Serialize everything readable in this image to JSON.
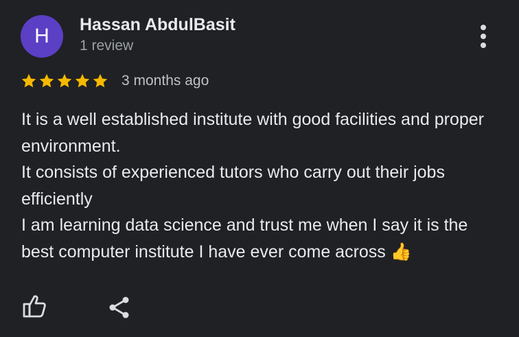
{
  "reviewer": {
    "initial": "H",
    "name": "Hassan AbdulBasit",
    "review_count": "1 review",
    "avatar_color": "#5b3fc4"
  },
  "review": {
    "rating": 5,
    "max_rating": 5,
    "star_color": "#f6b900",
    "time": "3 months ago",
    "lines": [
      "It is a well established institute with good facilities and proper environment.",
      "It consists of experienced tutors who carry out their jobs efficiently",
      "I am learning data science and trust me when I say it is the best computer institute I have ever come across"
    ],
    "emoji": "👍"
  },
  "actions": {
    "like_icon": "thumbs-up-outline-icon",
    "share_icon": "share-icon",
    "menu_icon": "more-vertical-icon"
  },
  "colors": {
    "background": "#202124",
    "text": "#e8eaed",
    "secondary_text": "#9aa0a6"
  }
}
